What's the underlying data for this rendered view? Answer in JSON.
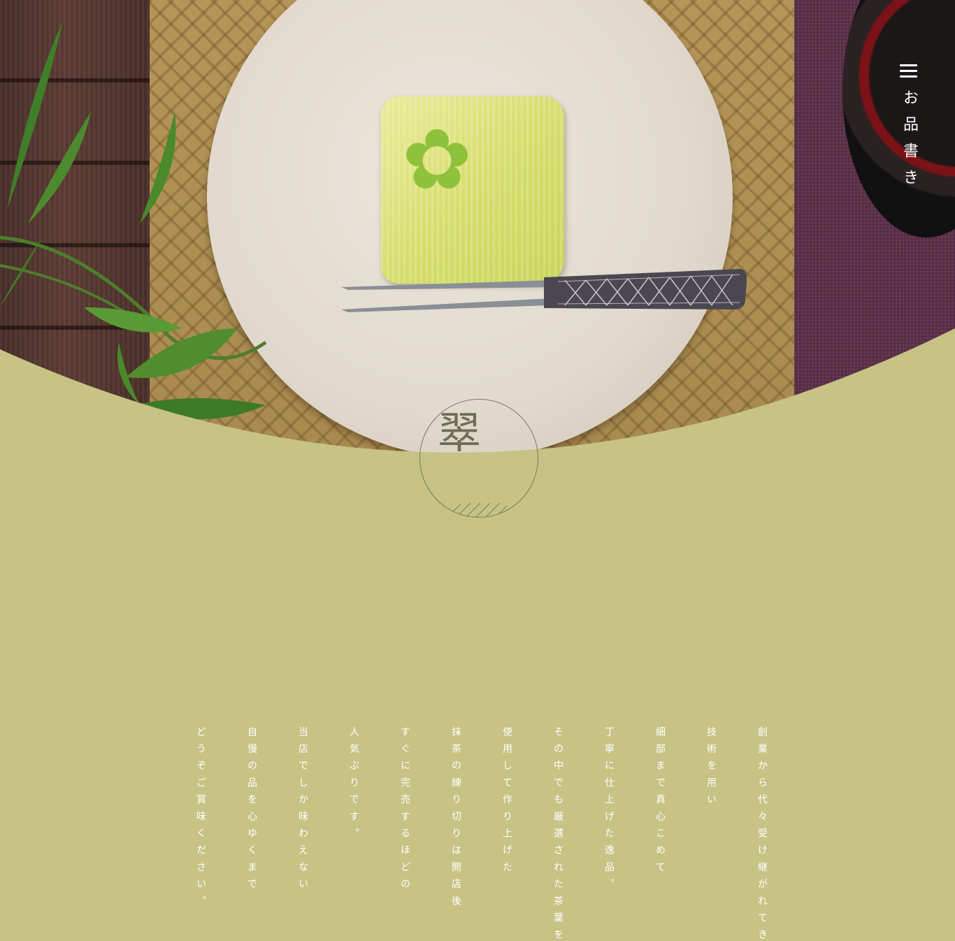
{
  "nav": {
    "menu_icon": "hamburger-menu-icon",
    "menu_label": "お品書き"
  },
  "hero": {
    "image": "wagashi-on-plate-photo"
  },
  "emblem": {
    "character": "翠"
  },
  "intro": {
    "lines": [
      "創業から代々受け継がれてき",
      "技術を用い",
      "細部まで真心こめて",
      "丁寧に仕上げた逸品。",
      "その中でも厳選された茶葉を",
      "使用して作り上げた",
      "抹茶の練り切りは開店後",
      "すぐに完売するほどの",
      "人気ぶりです。",
      "当店でしか味わえない",
      "自慢の品を心ゆくまで",
      "どうぞご賞味ください。"
    ]
  },
  "colors": {
    "background": "#c6c385",
    "nav_text": "#ffffff",
    "body_text": "#ffffff",
    "emblem_line": "#7c7b5a"
  }
}
